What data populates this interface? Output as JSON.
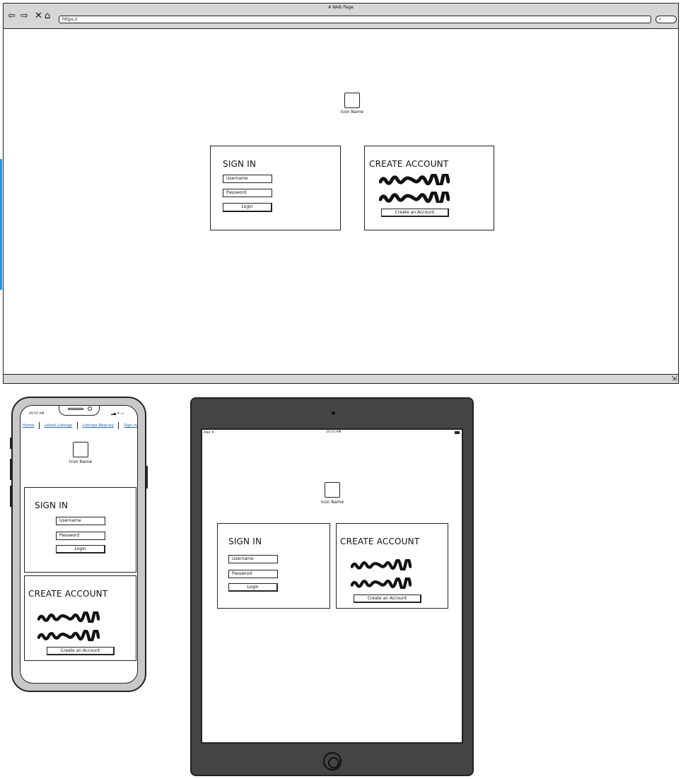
{
  "browser": {
    "title": "A Web Page",
    "nav_icons": {
      "back": "back-arrow-icon",
      "forward": "forward-arrow-icon",
      "close": "close-icon",
      "home": "home-icon"
    },
    "url": "https://",
    "search_icon": "search-icon",
    "resize_icon": "resize-grip-icon"
  },
  "logo": {
    "label": "Icon Name",
    "icon": "image-placeholder-icon"
  },
  "sign_in": {
    "title": "SIGN IN",
    "username_placeholder": "Username",
    "password_placeholder": "Password",
    "password_placeholder_tablet": "Passwrod",
    "login_label": "Login"
  },
  "create_account": {
    "title": "CREATE ACCOUNT",
    "button_label": "Create an Account"
  },
  "phone": {
    "time": "09:52 AM",
    "nav": [
      "Home",
      "Latest Listings",
      "Listings Near-by",
      "Sign In"
    ]
  },
  "tablet": {
    "device": "iPad",
    "time": "10:14 AM"
  },
  "colors": {
    "link": "#2966b8",
    "frame": "#444444",
    "chrome": "#d6d6d6",
    "accent_edge": "#2f8fe0"
  }
}
